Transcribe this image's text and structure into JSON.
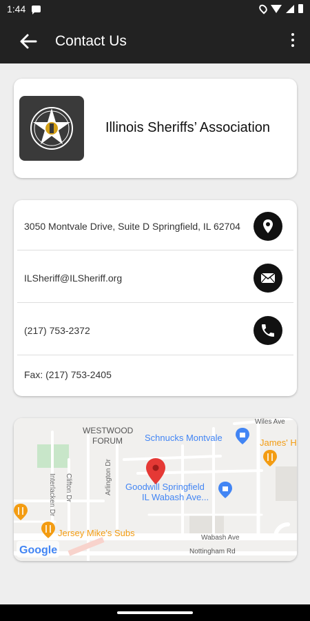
{
  "status": {
    "time": "1:44"
  },
  "appbar": {
    "title": "Contact Us"
  },
  "org": {
    "name": "Illinois Sheriffs’ Association"
  },
  "contact": {
    "address": "3050 Montvale Drive, Suite D Springfield, IL 62704",
    "email": "ILSheriff@ILSheriff.org",
    "phone": "(217) 753-2372",
    "fax": "Fax: (217) 753-2405"
  },
  "map": {
    "labels": {
      "westwood": "WESTWOOD",
      "forum": "FORUM",
      "schnucks": "Schnucks Montvale",
      "james": "James' H",
      "goodwill_1": "Goodwill Springfield",
      "goodwill_2": "IL Wabash Ave...",
      "jersey": "Jersey Mike's Subs",
      "wabash": "Wabash Ave",
      "nottingham": "Nottingham Rd",
      "wiles": "Wiles Ave",
      "interlacken": "Interlacken Dr",
      "clifton": "Clifton Dr",
      "arlington": "Arlington Dr",
      "google": "Google"
    }
  },
  "colors": {
    "bar": "#222222",
    "icon_bg": "#111111",
    "map_bg": "#f1f0ee",
    "poi_blue": "#4285f4",
    "poi_orange": "#f39c12",
    "pin_red": "#e53935"
  }
}
